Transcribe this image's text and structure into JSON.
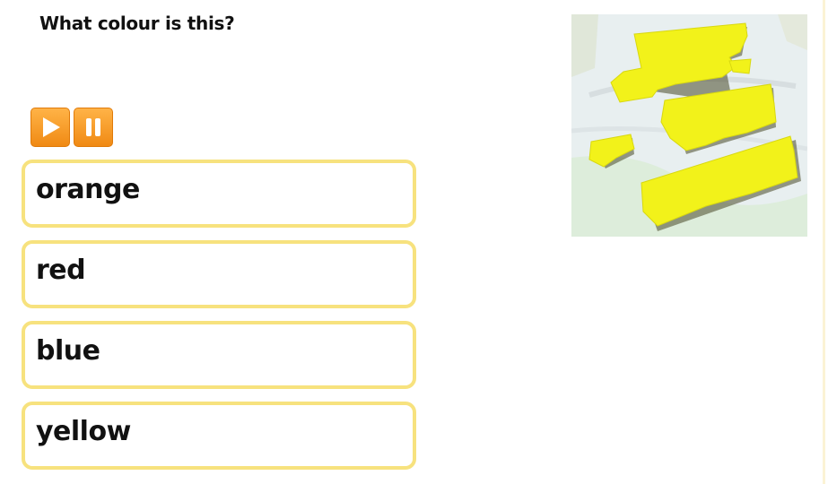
{
  "question": {
    "text": "What colour is this?"
  },
  "media": {
    "play_icon": "play-icon",
    "pause_icon": "pause-icon",
    "accent": "#f59420"
  },
  "answers": [
    {
      "label": "orange"
    },
    {
      "label": "red"
    },
    {
      "label": "blue"
    },
    {
      "label": "yellow"
    }
  ],
  "colors": {
    "answer_border": "#f7e27e",
    "paint": "#f2f21a"
  }
}
